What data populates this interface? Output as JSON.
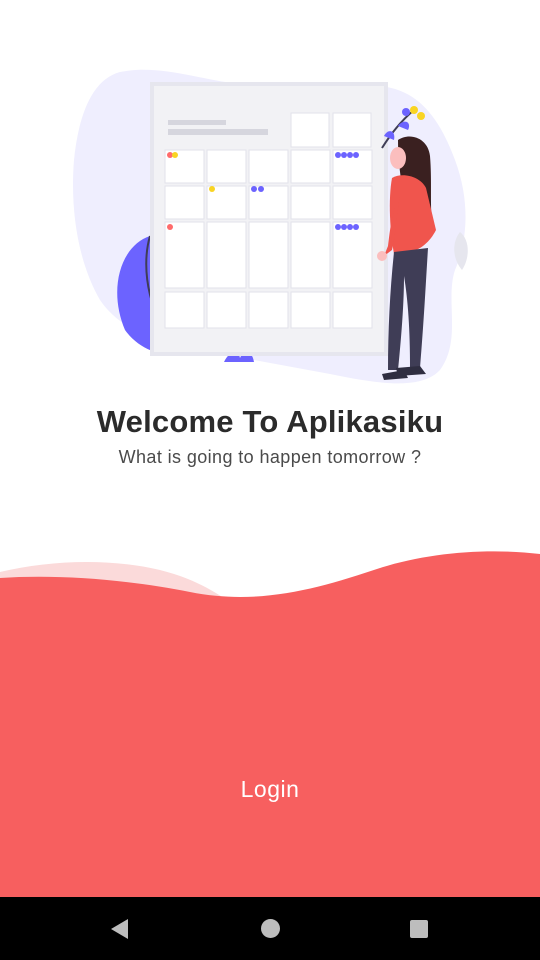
{
  "welcome": {
    "title": "Welcome To Aplikasiku",
    "subtitle": "What is going to happen tomorrow ?"
  },
  "login": {
    "label": "Login"
  },
  "navigation": {
    "buttons": [
      "back",
      "home",
      "recents"
    ]
  },
  "colors": {
    "accent": "#f75f5f",
    "accent_light": "#fbdada",
    "blob": "#efeefe",
    "leaf": "#6c63ff",
    "calendar_bg": "#f2f2f5",
    "dot_red": "#ff6b6b",
    "dot_yellow": "#f9d423",
    "dot_blue": "#6c63ff",
    "shirt": "#f0554d",
    "pants": "#3f3d56",
    "hair": "#3a2020"
  }
}
